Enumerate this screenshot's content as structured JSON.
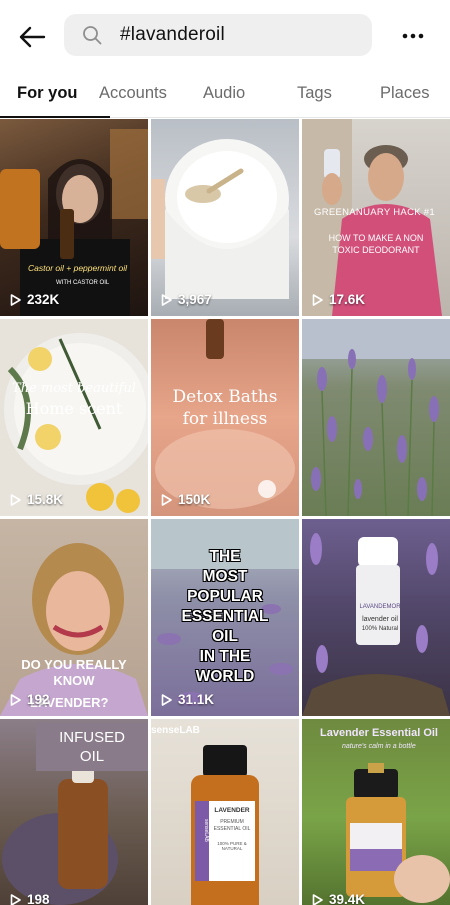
{
  "search": {
    "query": "#lavanderoil"
  },
  "tabs": [
    {
      "label": "For you",
      "active": true
    },
    {
      "label": "Accounts"
    },
    {
      "label": "Audio"
    },
    {
      "label": "Tags"
    },
    {
      "label": "Places"
    }
  ],
  "tiles": [
    {
      "views": "232K",
      "caption": "Castor oil + peppermint oil",
      "subcaption": "WITH CASTOR OIL"
    },
    {
      "views": "3,967",
      "caption": ""
    },
    {
      "views": "17.6K",
      "caption_line1": "GREENANUARY HACK #1",
      "caption_line2": "HOW TO MAKE A NON TOXIC DEODORANT"
    },
    {
      "views": "15.8K",
      "caption_line1": "The most beautiful",
      "caption_line2": "Home scent"
    },
    {
      "views": "150K",
      "caption_line1": "Detox Baths",
      "caption_line2": "for illness"
    },
    {
      "views": "",
      "caption": ""
    },
    {
      "views": "192",
      "caption_line1": "DO YOU REALLY KNOW",
      "caption_line2": "LAVENDER?"
    },
    {
      "views": "31.1K",
      "caption_lines": [
        "THE",
        "MOST",
        "POPULAR",
        "ESSENTIAL",
        "OIL",
        "IN THE",
        "WORLD"
      ]
    },
    {
      "views": "",
      "label_brand": "LAVANDEMOR",
      "label_name": "lavender oil",
      "label_sub": "100% Natural"
    },
    {
      "views": "198",
      "caption_line1": "INFUSED",
      "caption_line2": "OIL"
    },
    {
      "views": "",
      "brand": "senseLAB",
      "label_name": "LAVENDER",
      "label_sub1": "PREMIUM",
      "label_sub2": "ESSENTIAL OIL",
      "label_sub3": "100% PURE & NATURAL",
      "bottle_brand": "senseLAB"
    },
    {
      "views": "39.4K",
      "caption": "Lavender Essential Oil",
      "subcaption": "nature's calm in a bottle"
    }
  ]
}
